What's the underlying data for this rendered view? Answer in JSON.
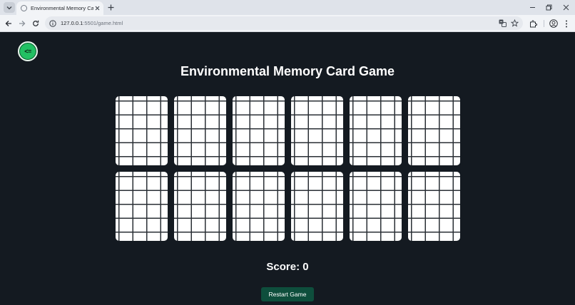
{
  "browser": {
    "tab_title": "Environmental Memory Card G",
    "url_host": "127.0.0.1",
    "url_path": ":5501/game.html"
  },
  "page": {
    "back_label": "<=",
    "title": "Environmental Memory Card Game",
    "score_label": "Score: 0",
    "restart_label": "Restart Game"
  },
  "board": {
    "columns": 6,
    "rows": 2,
    "cards": [
      {
        "state": "face-down"
      },
      {
        "state": "face-down"
      },
      {
        "state": "face-down"
      },
      {
        "state": "face-down"
      },
      {
        "state": "face-down"
      },
      {
        "state": "face-down"
      },
      {
        "state": "face-down"
      },
      {
        "state": "face-down"
      },
      {
        "state": "face-down"
      },
      {
        "state": "face-down"
      },
      {
        "state": "face-down"
      },
      {
        "state": "face-down"
      }
    ]
  },
  "colors": {
    "page_background": "#141a21",
    "back_button": "#22c063",
    "restart_button": "#0e4e3c",
    "card_face": "#ffffff",
    "card_grid": "#2a2f35"
  }
}
